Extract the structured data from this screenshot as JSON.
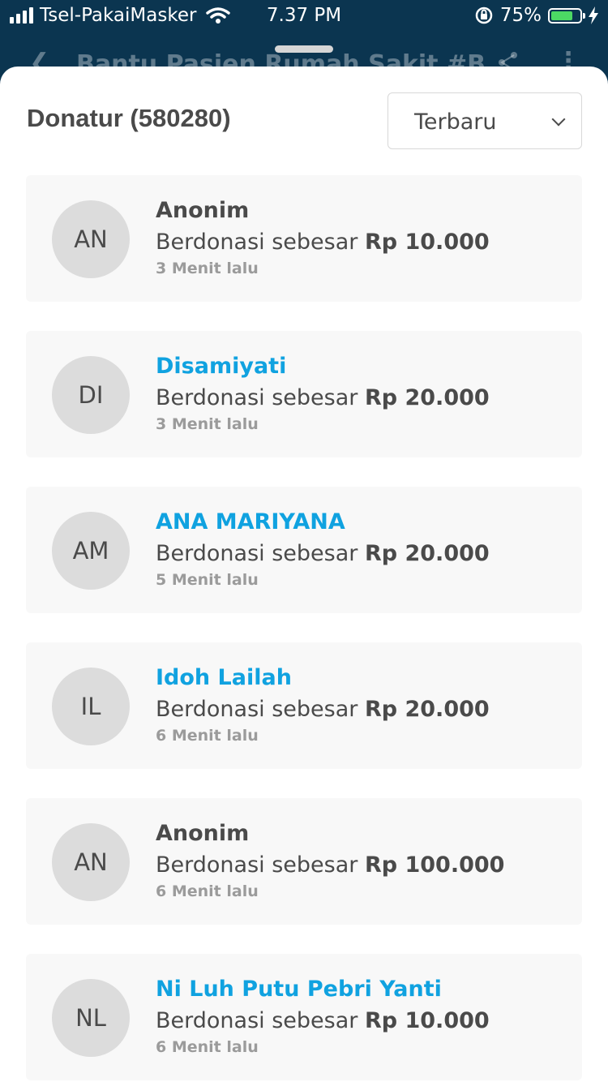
{
  "status_bar": {
    "carrier": "Tsel-PakaiMasker",
    "time": "7.37 PM",
    "battery_percent": "75%",
    "battery_level": 0.75
  },
  "header": {
    "title": "Bantu Pasien Rumah Sakit #B"
  },
  "donors": {
    "title": "Donatur (580280)",
    "sort_value": "Terbaru",
    "amount_prefix": "Berdonasi sebesar",
    "items": [
      {
        "initials": "AN",
        "name": "Anonim",
        "amount": "Rp 10.000",
        "time": "3 Menit lalu",
        "link": false
      },
      {
        "initials": "DI",
        "name": "Disamiyati",
        "amount": "Rp 20.000",
        "time": "3 Menit lalu",
        "link": true
      },
      {
        "initials": "AM",
        "name": "ANA MARIYANA",
        "amount": "Rp 20.000",
        "time": "5 Menit lalu",
        "link": true
      },
      {
        "initials": "IL",
        "name": "Idoh Lailah",
        "amount": "Rp 20.000",
        "time": "6 Menit lalu",
        "link": true
      },
      {
        "initials": "AN",
        "name": "Anonim",
        "amount": "Rp 100.000",
        "time": "6 Menit lalu",
        "link": false
      },
      {
        "initials": "NL",
        "name": "Ni Luh Putu Pebri Yanti",
        "amount": "Rp 10.000",
        "time": "6 Menit lalu",
        "link": true
      }
    ]
  },
  "colors": {
    "header_bg": "#0b3550",
    "link": "#10a2e0",
    "text": "#4a4a4a",
    "battery": "#4cd964"
  }
}
